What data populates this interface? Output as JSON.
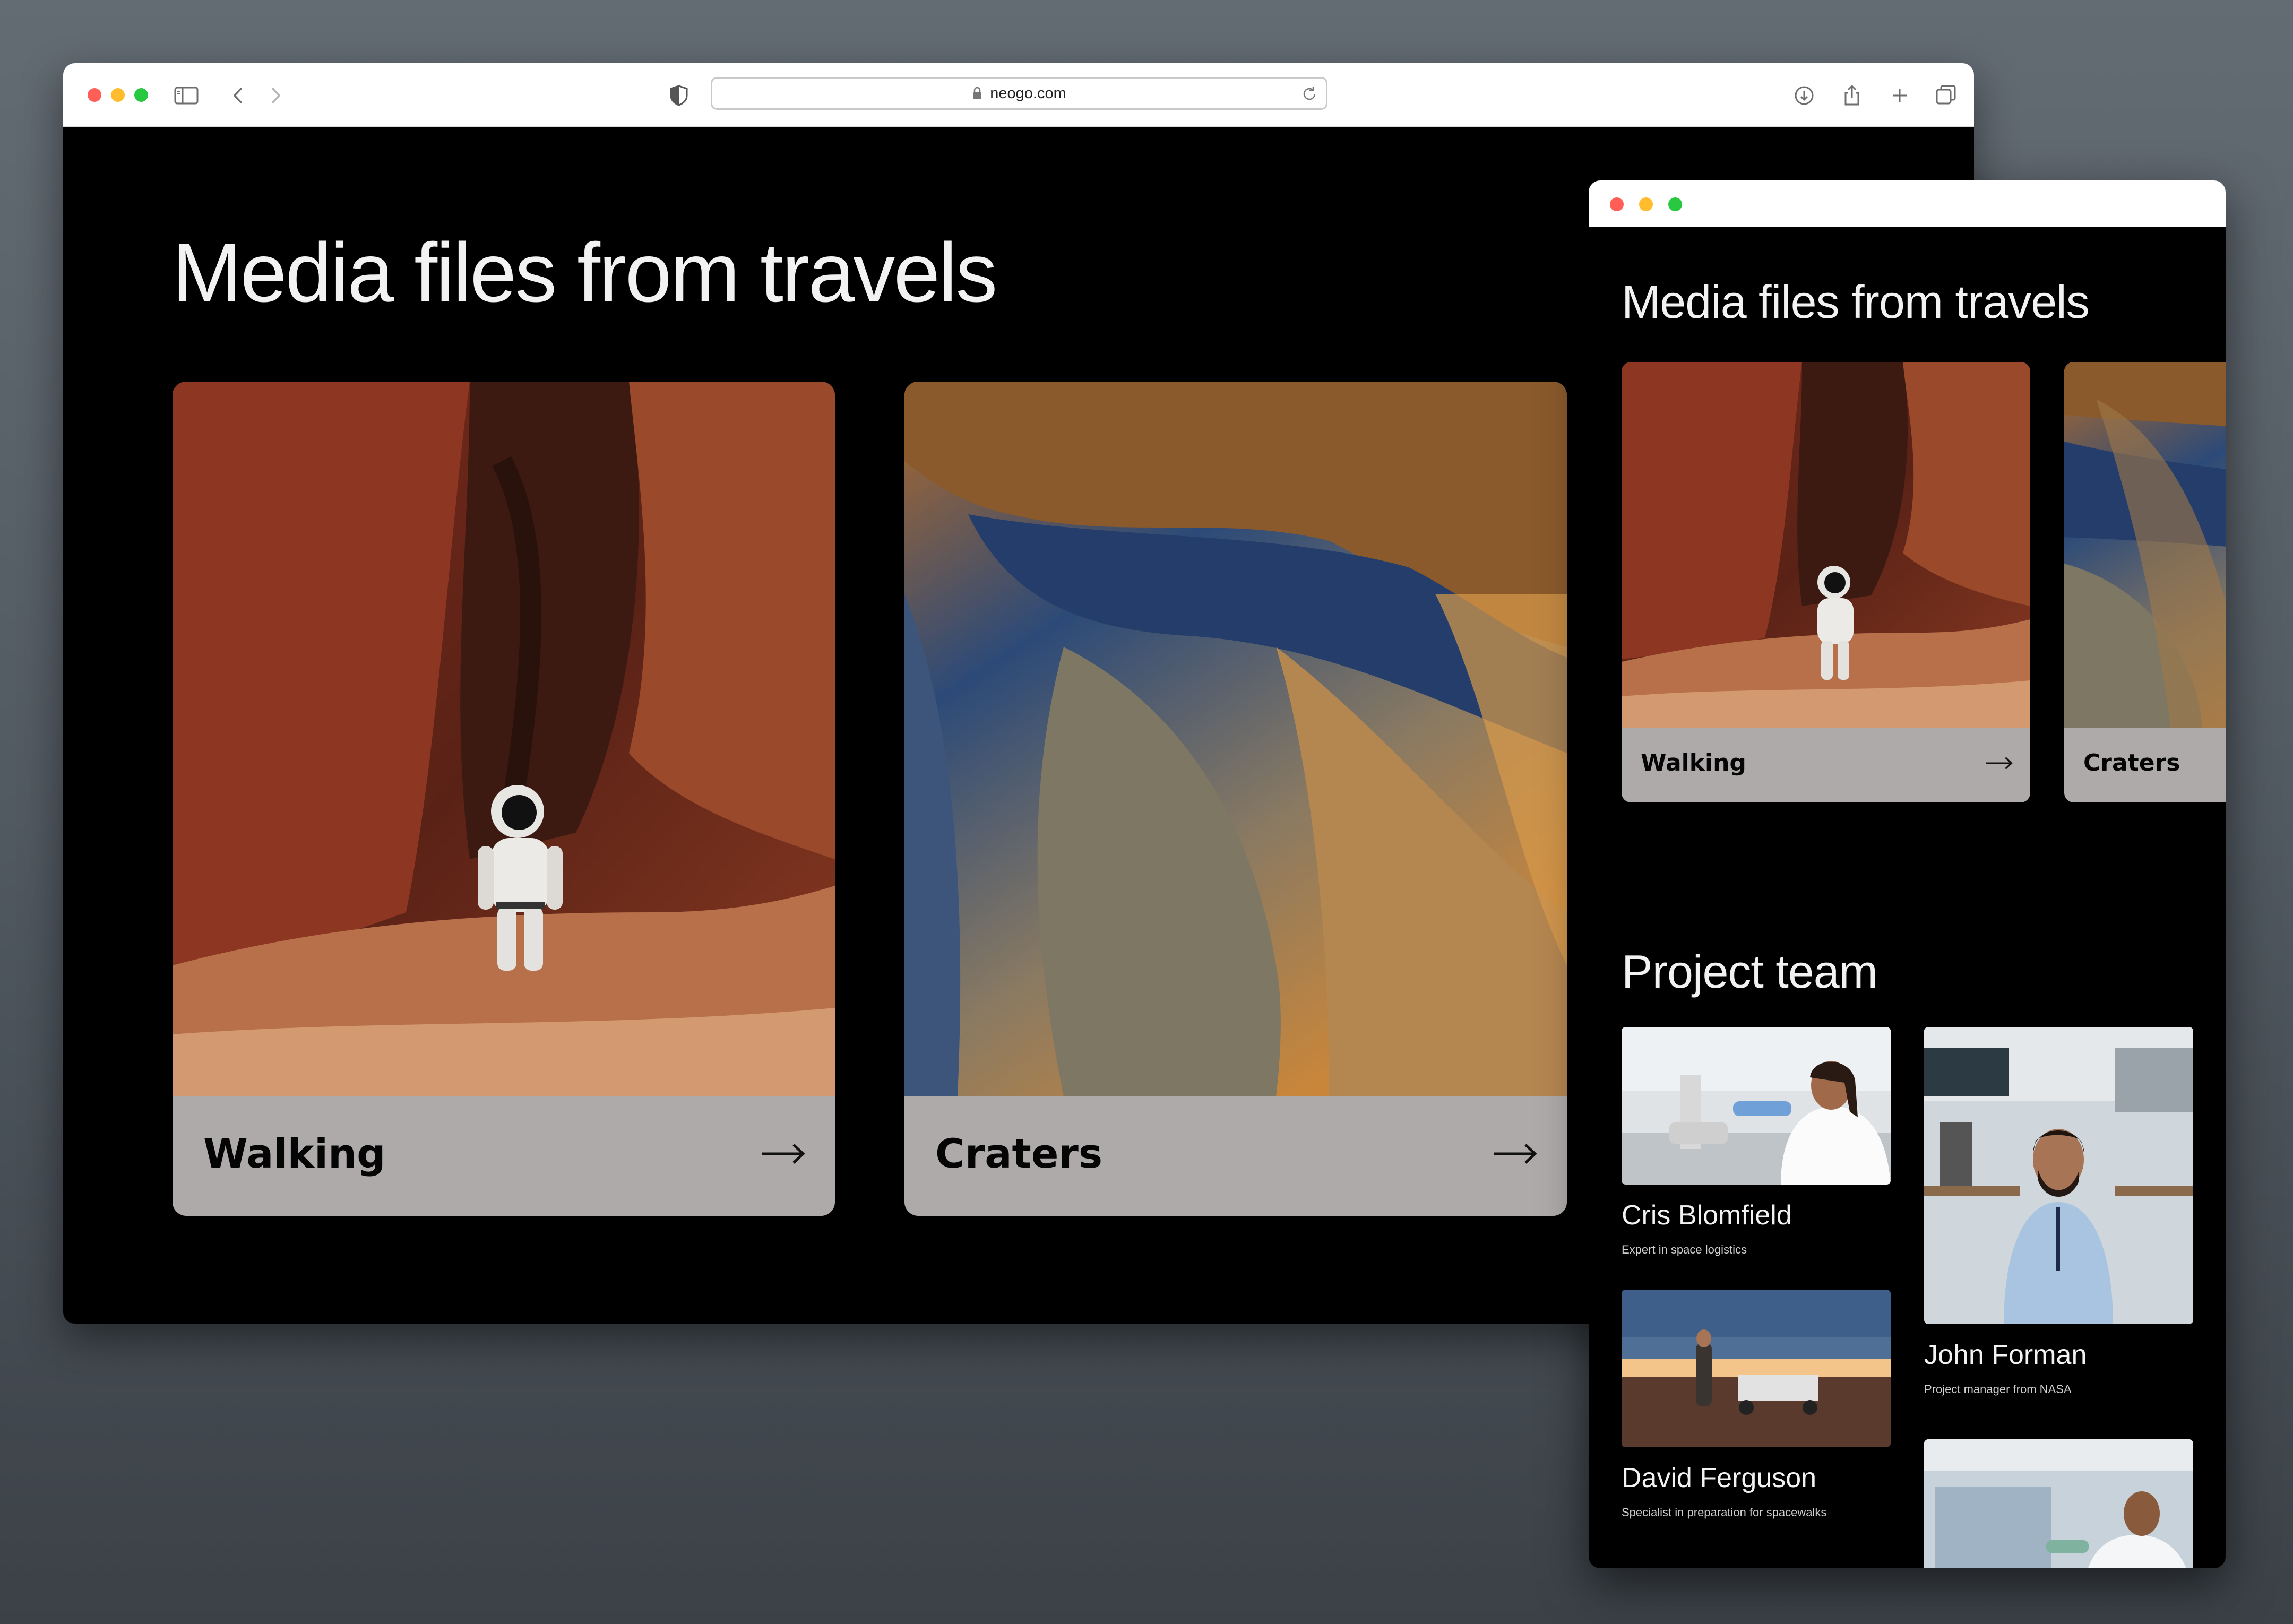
{
  "browser": {
    "url": "neogo.com",
    "icons": [
      "sidebar-icon",
      "back-icon",
      "forward-icon",
      "shield-icon",
      "lock-icon",
      "reload-icon",
      "download-icon",
      "share-icon",
      "new-tab-icon",
      "tabs-overview-icon"
    ],
    "traffic_light_colors": {
      "close": "#ff5f57",
      "minimize": "#febc2e",
      "zoom": "#28c840"
    }
  },
  "desktop": {
    "heading": "Media files from travels",
    "cards": [
      {
        "label": "Walking",
        "arrow": "→",
        "photo": "astronaut-in-red-canyon"
      },
      {
        "label": "Craters",
        "arrow": "→",
        "photo": "mars-crater-aerial"
      }
    ]
  },
  "mobile": {
    "heading": "Media files from travels",
    "cards": [
      {
        "label": "Walking",
        "arrow": "→"
      },
      {
        "label": "Craters"
      }
    ],
    "team_heading": "Project team",
    "team": [
      {
        "name": "Cris Blomfield",
        "role": "Expert in space logistics",
        "photo": "scientist-at-microscope"
      },
      {
        "name": "John Forman",
        "role": "Project manager from NASA",
        "photo": "man-in-lab"
      },
      {
        "name": "David Ferguson",
        "role": "Specialist in preparation for spacewalks",
        "photo": "man-with-rover-in-field"
      },
      {
        "name": "",
        "role": "",
        "photo": "researcher-at-lab-bench"
      }
    ]
  },
  "colors": {
    "page_background": "#5a6168",
    "window_background": "#000000",
    "card_footer": "#aeaaaa",
    "heading_text": "#f2f2f2"
  }
}
